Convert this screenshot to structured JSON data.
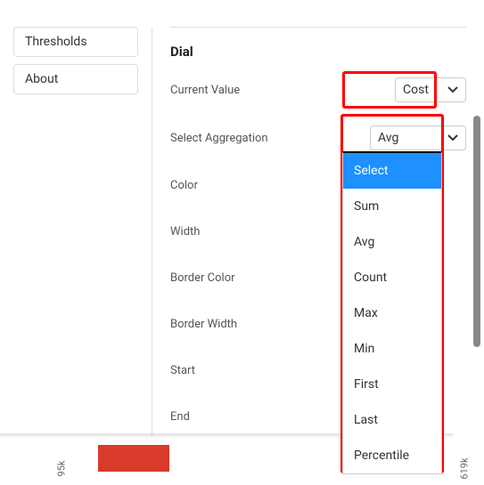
{
  "close_icon": "×",
  "sidebar": {
    "items": [
      {
        "label": "Thresholds"
      },
      {
        "label": "About"
      }
    ]
  },
  "section": {
    "title": "Dial"
  },
  "form": {
    "current_value": {
      "label": "Current Value",
      "value": "Cost"
    },
    "select_aggregation": {
      "label": "Select Aggregation",
      "value": "Avg"
    },
    "color": {
      "label": "Color"
    },
    "width": {
      "label": "Width"
    },
    "border_color": {
      "label": "Border Color"
    },
    "border_width": {
      "label": "Border Width"
    },
    "start": {
      "label": "Start"
    },
    "end": {
      "label": "End"
    }
  },
  "dropdown": {
    "options": [
      "Select",
      "Sum",
      "Avg",
      "Count",
      "Max",
      "Min",
      "First",
      "Last",
      "Percentile"
    ],
    "selected_index": 0
  },
  "background_chart": {
    "left_label": "95k",
    "right_label": "619k"
  }
}
